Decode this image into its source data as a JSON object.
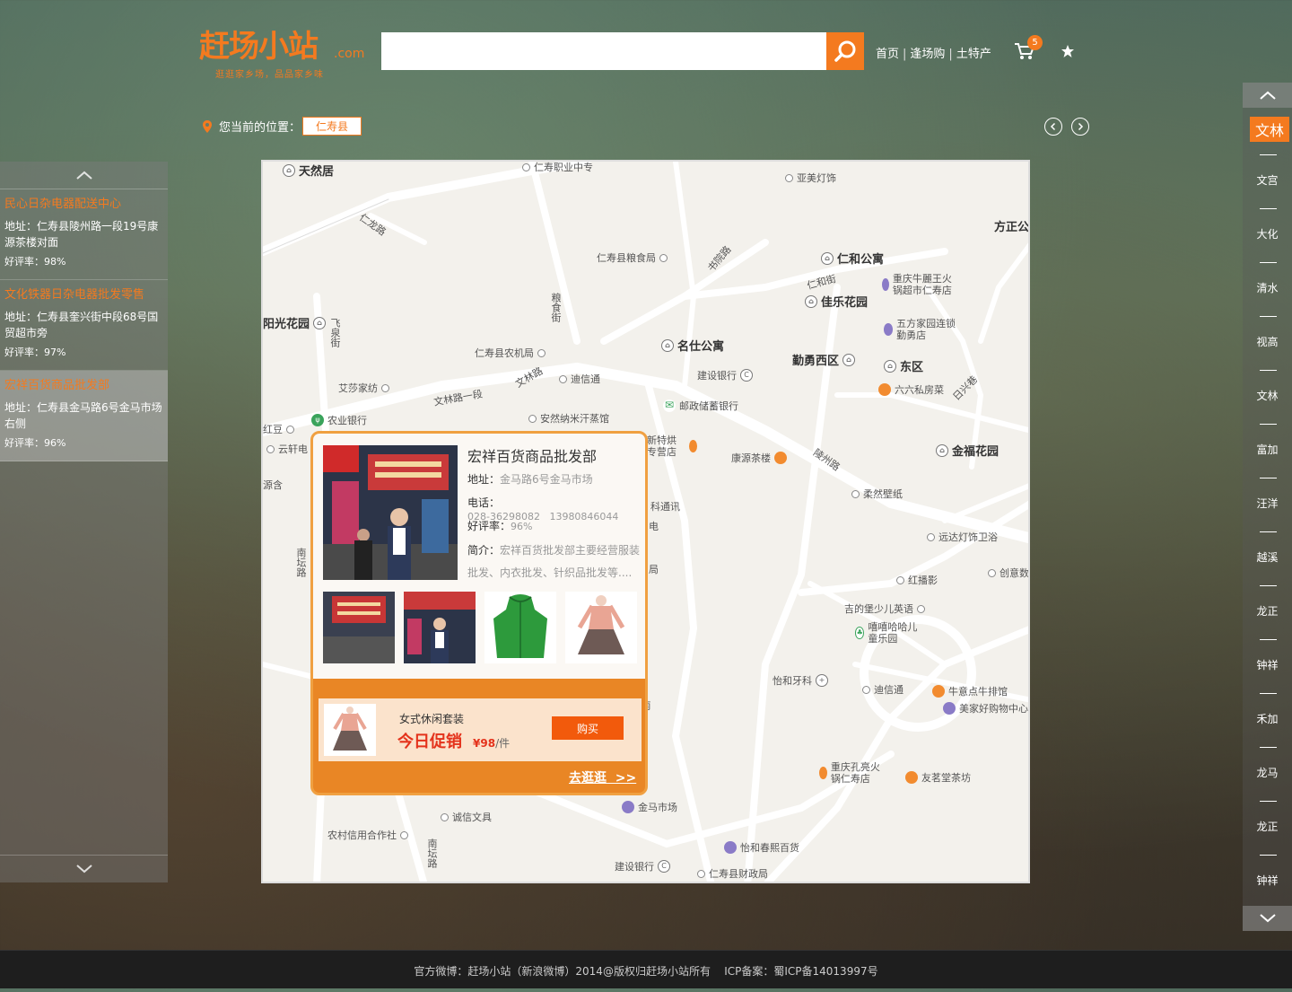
{
  "brand": {
    "logo_text": "赶场小站",
    "logo_suffix": ".com",
    "slogan": "逛逛家乡场，品品家乡味"
  },
  "search": {
    "placeholder": "",
    "value": ""
  },
  "topnav": {
    "items": [
      "首页",
      "逢场购",
      "土特产"
    ]
  },
  "cart": {
    "count": "5"
  },
  "location": {
    "label": "您当前的位置：",
    "value": "仁寿县"
  },
  "stores": [
    {
      "name": "民心日杂电器配送中心",
      "address": "地址：仁寿县陵州路一段19号康源茶楼对面",
      "rating": "好评率：98%"
    },
    {
      "name": "文化铁器日杂电器批发零售",
      "address": "地址：仁寿县奎兴街中段68号国贸超市旁",
      "rating": "好评率：97%"
    },
    {
      "name": "宏祥百货商品批发部",
      "address": "地址：仁寿县金马路6号金马市场右侧",
      "rating": "好评率：96%"
    }
  ],
  "map": {
    "pois": [
      "天然居",
      "仁寿职业中专",
      "亚美灯饰",
      "方正公",
      "仁寿县粮食局",
      "仁和公寓",
      "重庆牛麗王火锅超市仁寿店",
      "佳乐花园",
      "五方家园连锁勤勇店",
      "阳光花园",
      "仁寿县农机局",
      "名仕公寓",
      "勤勇西区",
      "东区",
      "艾莎家纺",
      "迪信通",
      "建设银行",
      "六六私房菜",
      "农业银行",
      "安然纳米汗蒸馆",
      "邮政储蓄银行",
      "新特烘专营店",
      "康源茶楼",
      "金福花园",
      "红豆",
      "云轩电",
      "柔然壁纸",
      "远达灯饰卫浴",
      "红播影",
      "创意数",
      "吉的堡少儿英语",
      "嘻嘻哈哈儿童乐园",
      "怡和牙科",
      "迪信通",
      "牛意点牛排馆",
      "美家好购物中心",
      "重庆孔亮火锅仁寿店",
      "友茗堂茶坊",
      "金马市场",
      "诚信文具",
      "农村信用合作社",
      "怡和春熙百货",
      "建设银行",
      "仁寿县财政局",
      "科通讯",
      "电",
      "局",
      "源含"
    ],
    "roads": [
      "仁龙路",
      "书院路",
      "粮食街",
      "仁和街",
      "飞泉街",
      "文林路",
      "文林路一段",
      "陵州路",
      "日兴巷",
      "南坛路",
      "南坛路",
      "南"
    ]
  },
  "popup": {
    "title": "宏祥百货商品批发部",
    "address_label": "地址：",
    "address": "金马路6号金马市场",
    "phone_label": "电话：",
    "phone": "028-36298082   13980846044",
    "rating_label": "好评率：",
    "rating": "96%",
    "intro_label": "简介：",
    "intro": "宏祥百货批发部主要经营服装批发、内衣批发、针织品批发等....",
    "promo_name": "女式休闲套装",
    "promo_tag": "今日促销",
    "promo_price": "¥98",
    "promo_unit": "/件",
    "buy_label": "购买",
    "go_label": "去逛逛  >>"
  },
  "towns": {
    "active": "文林",
    "items": [
      "文宫",
      "大化",
      "清水",
      "视高",
      "文林",
      "富加",
      "汪洋",
      "越溪",
      "龙正",
      "钟祥",
      "禾加",
      "龙马",
      "龙正",
      "钟祥"
    ]
  },
  "footer": {
    "text": "官方微博：赶场小站（新浪微博）2014@版权归赶场小站所有    ICP备案：蜀ICP备14013997号"
  },
  "colors": {
    "accent": "#f47a1f",
    "promo_red": "#e4321b",
    "popup_border": "#f0a041"
  }
}
